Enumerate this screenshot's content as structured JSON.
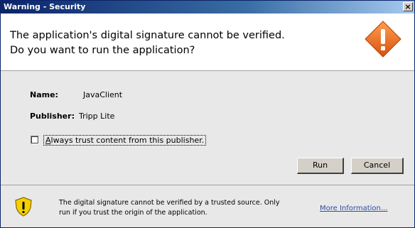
{
  "window": {
    "title": "Warning - Security",
    "close_glyph": "×"
  },
  "header": {
    "message_line1": "The application's digital signature cannot be verified.",
    "message_line2": "Do you want to run the application?",
    "icon": "warning-diamond-icon"
  },
  "details": {
    "name_label": "Name:",
    "name_value": "JavaClient",
    "publisher_label": "Publisher:",
    "publisher_value": "Tripp Lite"
  },
  "trust_checkbox": {
    "accel": "A",
    "label_rest": "lways trust content from this publisher.",
    "checked": false
  },
  "buttons": {
    "run_label": "Run",
    "cancel_label": "Cancel"
  },
  "footer": {
    "icon": "shield-warning-icon",
    "line1": "The digital signature cannot be verified by a trusted source.  Only",
    "line2": "run if you trust the origin of the application.",
    "more_info_label": "More Information..."
  },
  "colors": {
    "title_bar_start": "#0a246a",
    "title_bar_end": "#a6caf0",
    "warning_orange": "#f07020",
    "shield_yellow": "#f5d000",
    "link_blue": "#2a4ea0"
  }
}
